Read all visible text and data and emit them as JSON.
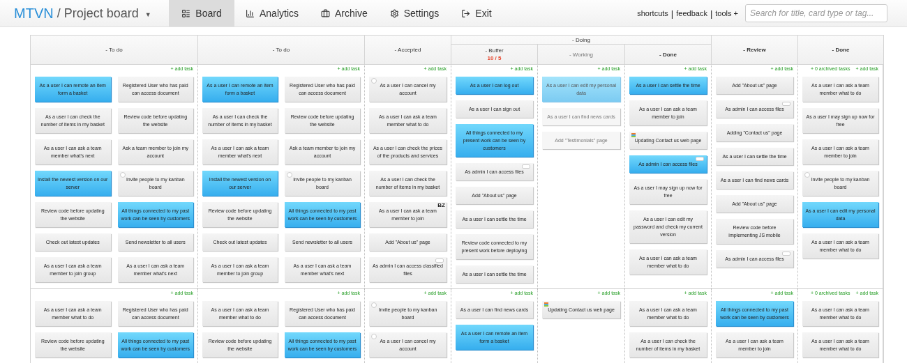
{
  "app": {
    "logo": "MTVN",
    "board_title": "/ Project board",
    "caret": "▼"
  },
  "nav": [
    {
      "label": "Board",
      "selected": true
    },
    {
      "label": "Analytics",
      "selected": false
    },
    {
      "label": "Archive",
      "selected": false
    },
    {
      "label": "Settings",
      "selected": false
    },
    {
      "label": "Exit",
      "selected": false
    }
  ],
  "links": [
    "shortcuts",
    "feedback",
    "tools +"
  ],
  "link_separator": "|",
  "search": {
    "placeholder": "Search for title, card type or tag..."
  },
  "column_headers": [
    {
      "label": "- To do"
    },
    {
      "label": "- To do"
    },
    {
      "label": "- Accepted"
    },
    {
      "label": "- Doing",
      "children": [
        {
          "label": "- Buffer",
          "limit": "10 / 5"
        },
        {
          "label": "- Working"
        },
        {
          "label": "- Done"
        }
      ]
    },
    {
      "label": "- Review"
    },
    {
      "label": "- Done"
    }
  ],
  "lanes": [
    {
      "cells": [
        {
          "add_task": "+ add task",
          "cards": [
            {
              "text": "As a user I can remote an item form a basket",
              "kind": "plain",
              "highlighted": true,
              "dimmed": false
            },
            {
              "text": "Registered User who has paid can access document",
              "kind": "plain",
              "highlighted": false,
              "dimmed": false
            },
            {
              "text": "As a user I can check the number of items in my basket",
              "kind": "plain",
              "highlighted": false,
              "dimmed": false
            },
            {
              "text": "Review code before updating the website",
              "kind": "plain",
              "highlighted": false,
              "dimmed": false
            },
            {
              "text": "As a user I can ask a team member what's next",
              "kind": "plain",
              "highlighted": false,
              "dimmed": false
            },
            {
              "text": "Ask a team member to join my account",
              "kind": "plain",
              "highlighted": false,
              "dimmed": false
            },
            {
              "text": "Install the newest version on our server",
              "kind": "plain",
              "highlighted": true,
              "dimmed": false
            },
            {
              "text": "Invite people to my kanban board",
              "kind": "pin",
              "highlighted": false,
              "dimmed": false
            },
            {
              "text": "Review code before updating the website",
              "kind": "plain",
              "highlighted": false,
              "dimmed": false
            },
            {
              "text": "All things connected to my past work can be seen by customers",
              "kind": "plain",
              "highlighted": true,
              "dimmed": false
            },
            {
              "text": "Check out latest updates",
              "kind": "plain",
              "highlighted": false,
              "dimmed": false
            },
            {
              "text": "Send newsletter to all users",
              "kind": "plain",
              "highlighted": false,
              "dimmed": false
            },
            {
              "text": "As a user I can ask a team member to join group",
              "kind": "plain",
              "highlighted": false,
              "dimmed": false
            },
            {
              "text": "As a user I can ask a team member what's next",
              "kind": "plain",
              "highlighted": false,
              "dimmed": false
            }
          ]
        },
        {
          "add_task": "+ add task",
          "cards": [
            {
              "text": "As a user I can remote an item form a basket",
              "kind": "plain",
              "highlighted": true,
              "dimmed": false
            },
            {
              "text": "Registered User who has paid can access document",
              "kind": "plain",
              "highlighted": false,
              "dimmed": false
            },
            {
              "text": "As a user I can check the number of items in my basket",
              "kind": "plain",
              "highlighted": false,
              "dimmed": false
            },
            {
              "text": "Review code before updating the website",
              "kind": "plain",
              "highlighted": false,
              "dimmed": false
            },
            {
              "text": "As a user I can ask a team member what's next",
              "kind": "plain",
              "highlighted": false,
              "dimmed": false
            },
            {
              "text": "Ask a team member to join my account",
              "kind": "plain",
              "highlighted": false,
              "dimmed": false
            },
            {
              "text": "Install the newest version on our server",
              "kind": "plain",
              "highlighted": true,
              "dimmed": false
            },
            {
              "text": "Invite people to my kanban board",
              "kind": "pin",
              "highlighted": false,
              "dimmed": false
            },
            {
              "text": "Review code before updating the website",
              "kind": "plain",
              "highlighted": false,
              "dimmed": false
            },
            {
              "text": "All things connected to my past work can be seen by customers",
              "kind": "plain",
              "highlighted": true,
              "dimmed": false
            },
            {
              "text": "Check out latest updates",
              "kind": "plain",
              "highlighted": false,
              "dimmed": false
            },
            {
              "text": "Send newsletter to all users",
              "kind": "plain",
              "highlighted": false,
              "dimmed": false
            },
            {
              "text": "As a user I can ask a team member to join group",
              "kind": "plain",
              "highlighted": false,
              "dimmed": false
            },
            {
              "text": "As a user I can ask a team member what's next",
              "kind": "plain",
              "highlighted": false,
              "dimmed": false
            }
          ]
        },
        {
          "add_task": "+ add task",
          "cards": [
            {
              "text": "As a user I can cancel my account",
              "kind": "pin",
              "highlighted": false,
              "dimmed": false
            },
            {
              "text": "As a user I can ask a team member what to do",
              "kind": "plain",
              "highlighted": false,
              "dimmed": false
            },
            {
              "text": "As a user I can check the prices of the products and services",
              "kind": "plain",
              "highlighted": false,
              "dimmed": false
            },
            {
              "text": "As a user I can check the number of items in my basket",
              "kind": "plain",
              "highlighted": false,
              "dimmed": false
            },
            {
              "text": "As a user I can ask a team member to join",
              "kind": "plain",
              "highlighted": false,
              "dimmed": false,
              "badge": "BZ"
            },
            {
              "text": "Add \"About us\" page",
              "kind": "plain",
              "highlighted": false,
              "dimmed": false
            },
            {
              "text": "As admin I can access classified files",
              "kind": "tab",
              "highlighted": false,
              "dimmed": false
            }
          ]
        },
        {
          "add_task": "+ add task",
          "cards": [
            {
              "text": "As a user I can log out",
              "kind": "plain",
              "highlighted": true,
              "dimmed": false
            },
            {
              "text": "As a user I can sign out",
              "kind": "plain",
              "highlighted": false,
              "dimmed": false
            },
            {
              "text": "All things connected to my present work can be seen by customers",
              "kind": "plain",
              "highlighted": true,
              "dimmed": false
            },
            {
              "text": "As admin I can access files",
              "kind": "tab",
              "highlighted": false,
              "dimmed": false
            },
            {
              "text": "Add \"About us\" page",
              "kind": "plain",
              "highlighted": false,
              "dimmed": false
            },
            {
              "text": "As a user I can settle the time",
              "kind": "plain",
              "highlighted": false,
              "dimmed": false
            },
            {
              "text": "Review code connected to my present work before deploying",
              "kind": "plain",
              "highlighted": false,
              "dimmed": false
            },
            {
              "text": "As a user I can settle the time",
              "kind": "plain",
              "highlighted": false,
              "dimmed": false
            }
          ]
        },
        {
          "add_task": "+ add task",
          "cards": [
            {
              "text": "As a user I can edit my personal data",
              "kind": "plain",
              "highlighted": true,
              "dimmed": true
            },
            {
              "text": "As a user I can find news cards",
              "kind": "plain",
              "highlighted": false,
              "dimmed": true
            },
            {
              "text": "Add \"Testimonials\" page",
              "kind": "plain",
              "highlighted": false,
              "dimmed": true
            }
          ]
        },
        {
          "add_task": "+ add task",
          "cards": [
            {
              "text": "As a user I can settle the time",
              "kind": "plain",
              "highlighted": true,
              "dimmed": false
            },
            {
              "text": "As a user I can ask a team member to join",
              "kind": "plain",
              "highlighted": false,
              "dimmed": false
            },
            {
              "text": "Updating Contact us web page",
              "kind": "flag",
              "highlighted": false,
              "dimmed": false
            },
            {
              "text": "As admin I can access files",
              "kind": "tab",
              "highlighted": true,
              "dimmed": false
            },
            {
              "text": "As a user I may sign up now for free",
              "kind": "plain",
              "highlighted": false,
              "dimmed": false
            },
            {
              "text": "As a user I can edit my password and check my current version",
              "kind": "plain",
              "highlighted": false,
              "dimmed": false
            },
            {
              "text": "As a user I can ask a team member what to do",
              "kind": "plain",
              "highlighted": false,
              "dimmed": false
            }
          ]
        },
        {
          "add_task": "+ add task",
          "cards": [
            {
              "text": "Add \"About us\" page",
              "kind": "plain",
              "highlighted": false,
              "dimmed": false
            },
            {
              "text": "As admin I can access files",
              "kind": "tab",
              "highlighted": false,
              "dimmed": false
            },
            {
              "text": "Adding \"Contact us\" page",
              "kind": "plain",
              "highlighted": false,
              "dimmed": false
            },
            {
              "text": "As a user I can settle the time",
              "kind": "plain",
              "highlighted": false,
              "dimmed": false
            },
            {
              "text": "As a user I can find news cards",
              "kind": "plain",
              "highlighted": false,
              "dimmed": false
            },
            {
              "text": "Add \"About us\" page",
              "kind": "plain",
              "highlighted": false,
              "dimmed": false
            },
            {
              "text": "Review code before implementing JS mobile",
              "kind": "plain",
              "highlighted": false,
              "dimmed": false
            },
            {
              "text": "As admin I can access files",
              "kind": "tab",
              "highlighted": false,
              "dimmed": false
            }
          ]
        },
        {
          "add_task": "+ add task",
          "archived": "+ 0 archived tasks",
          "cards": [
            {
              "text": "As a user I can ask a team member what to do",
              "kind": "plain",
              "highlighted": false,
              "dimmed": false
            },
            {
              "text": "As a user I may sign up now for free",
              "kind": "plain",
              "highlighted": false,
              "dimmed": false
            },
            {
              "text": "As a user I can ask a team member to join",
              "kind": "plain",
              "highlighted": false,
              "dimmed": false
            },
            {
              "text": "Invite people to my kanban board",
              "kind": "pin",
              "highlighted": false,
              "dimmed": false
            },
            {
              "text": "As a user I can edit my personal data",
              "kind": "plain",
              "highlighted": true,
              "dimmed": false
            },
            {
              "text": "As a user I can ask a team member what to do",
              "kind": "plain",
              "highlighted": false,
              "dimmed": false
            }
          ]
        }
      ]
    },
    {
      "cells": [
        {
          "add_task": "+ add task",
          "cards": [
            {
              "text": "As a user I can ask a team member what to do",
              "kind": "plain",
              "highlighted": false,
              "dimmed": false
            },
            {
              "text": "Registered User who has paid can access document",
              "kind": "plain",
              "highlighted": false,
              "dimmed": false
            },
            {
              "text": "Review code before updating the website",
              "kind": "plain",
              "highlighted": false,
              "dimmed": false
            },
            {
              "text": "All things connected to my past work can be seen by customers",
              "kind": "plain",
              "highlighted": true,
              "dimmed": false
            }
          ]
        },
        {
          "add_task": "+ add task",
          "cards": [
            {
              "text": "As a user I can ask a team member what to do",
              "kind": "plain",
              "highlighted": false,
              "dimmed": false
            },
            {
              "text": "Registered User who has paid can access document",
              "kind": "plain",
              "highlighted": false,
              "dimmed": false
            },
            {
              "text": "Review code before updating the website",
              "kind": "plain",
              "highlighted": false,
              "dimmed": false
            },
            {
              "text": "All things connected to my past work can be seen by customers",
              "kind": "plain",
              "highlighted": true,
              "dimmed": false
            }
          ]
        },
        {
          "add_task": "+ add task",
          "cards": [
            {
              "text": "Invite people to my kanban board",
              "kind": "pin",
              "highlighted": false,
              "dimmed": false
            },
            {
              "text": "As a user I can cancel my account",
              "kind": "pin",
              "highlighted": false,
              "dimmed": false
            }
          ]
        },
        {
          "add_task": "+ add task",
          "cards": [
            {
              "text": "As a user I can find news cards",
              "kind": "plain",
              "highlighted": false,
              "dimmed": false
            },
            {
              "text": "As a user I can remote an item form a basket",
              "kind": "plain",
              "highlighted": true,
              "dimmed": false
            }
          ]
        },
        {
          "add_task": "+ add task",
          "cards": [
            {
              "text": "Updating Contact us web page",
              "kind": "flag",
              "highlighted": false,
              "dimmed": false
            }
          ]
        },
        {
          "add_task": "+ add task",
          "cards": [
            {
              "text": "As a user I can ask a team member what to do",
              "kind": "plain",
              "highlighted": false,
              "dimmed": false
            },
            {
              "text": "As a user I can check the number of items in my basket",
              "kind": "plain",
              "highlighted": false,
              "dimmed": false
            }
          ]
        },
        {
          "add_task": "+ add task",
          "cards": [
            {
              "text": "All things connected to my past work can be seen by customers",
              "kind": "plain",
              "highlighted": true,
              "dimmed": false
            },
            {
              "text": "As a user I can ask a team member to join",
              "kind": "plain",
              "highlighted": false,
              "dimmed": false
            }
          ]
        },
        {
          "add_task": "+ add task",
          "archived": "+ 0 archived tasks",
          "cards": [
            {
              "text": "As a user I can ask a team member what to do",
              "kind": "plain",
              "highlighted": false,
              "dimmed": false
            },
            {
              "text": "As a user I can ask a team member what to do",
              "kind": "plain",
              "highlighted": false,
              "dimmed": false
            }
          ]
        }
      ]
    }
  ]
}
